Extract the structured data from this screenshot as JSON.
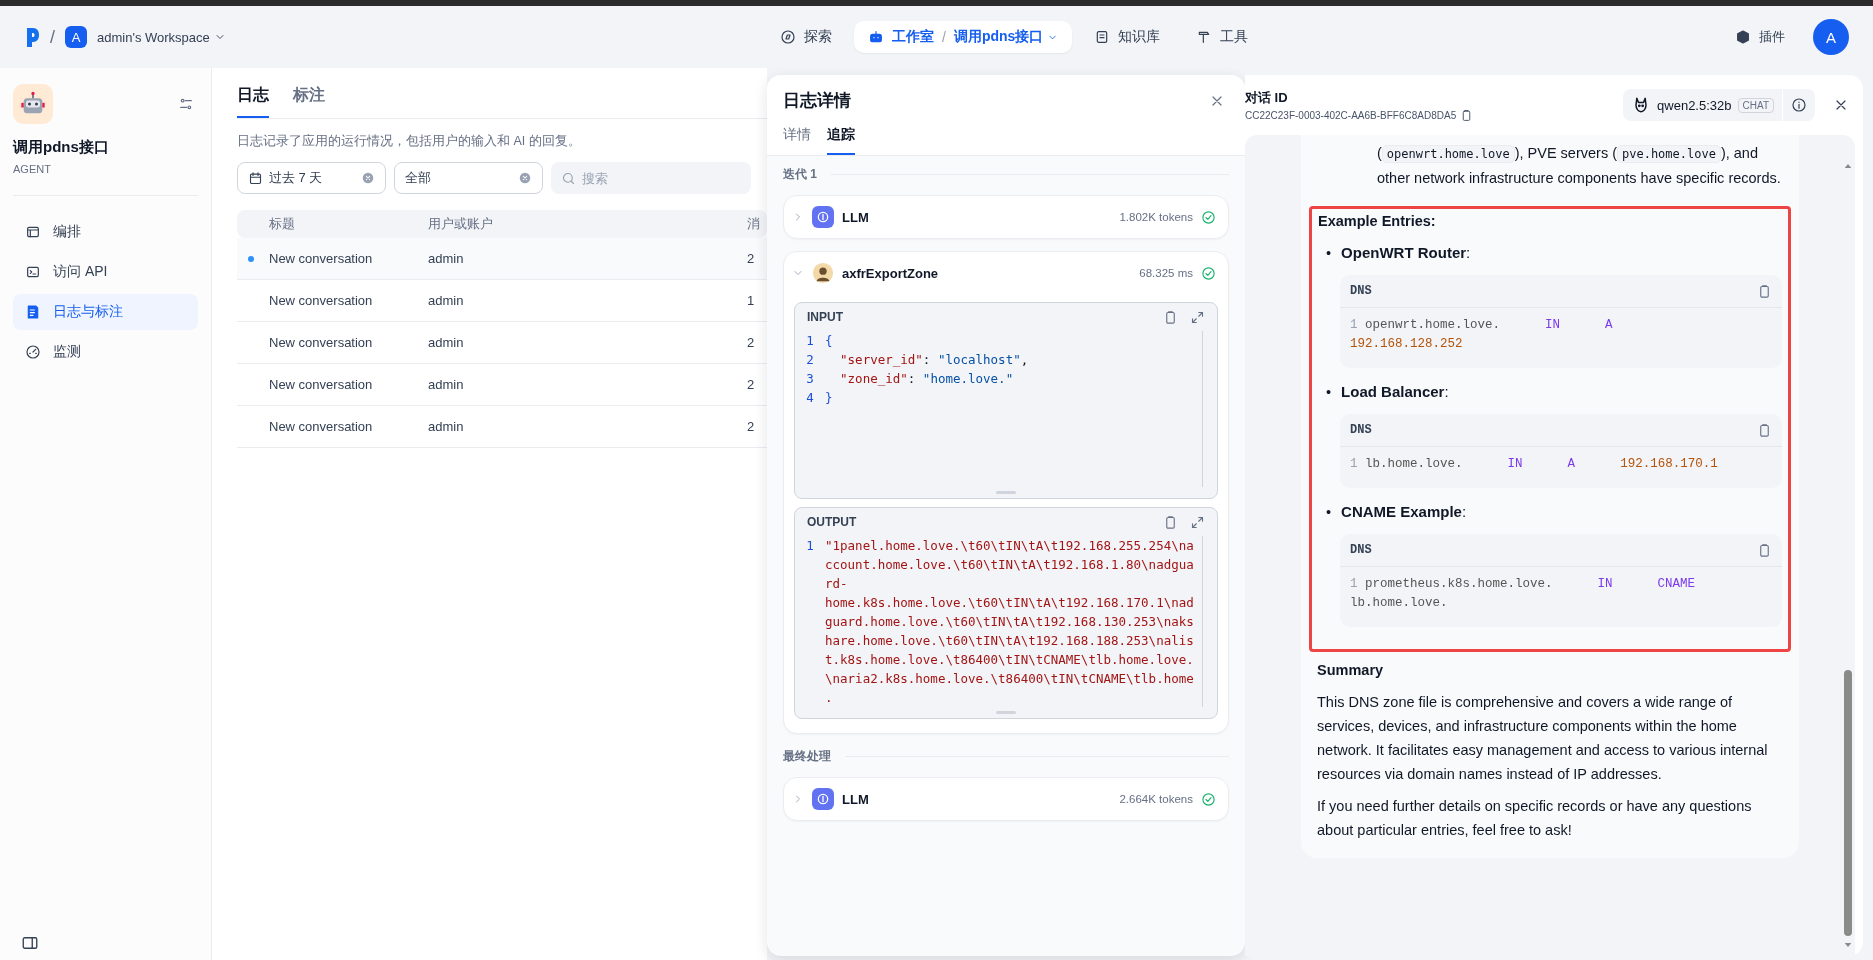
{
  "top_bar": {
    "separator": "/",
    "workspace": {
      "avatar": "A",
      "name": "admin's Workspace"
    },
    "nav": [
      {
        "label": "探索",
        "kind": "explore",
        "selected": false
      },
      {
        "label": "工作室",
        "kind": "studio",
        "selected": true,
        "app_separator": "/",
        "app": "调用pdns接口"
      },
      {
        "label": "知识库",
        "kind": "knowledge",
        "selected": false
      },
      {
        "label": "工具",
        "kind": "tools",
        "selected": false
      }
    ],
    "plugins": "插件",
    "avatar": "A"
  },
  "sidebar": {
    "app_name": "调用pdns接口",
    "app_type": "AGENT",
    "items": [
      {
        "label": "编排",
        "kind": "layout",
        "selected": false
      },
      {
        "label": "访问 API",
        "kind": "api",
        "selected": false
      },
      {
        "label": "日志与标注",
        "kind": "logs",
        "selected": true
      },
      {
        "label": "监测",
        "kind": "monitor",
        "selected": false
      }
    ]
  },
  "logs": {
    "tabs": [
      {
        "label": "日志",
        "selected": true
      },
      {
        "label": "标注",
        "selected": false
      }
    ],
    "description": "日志记录了应用的运行情况，包括用户的输入和 AI 的回复。",
    "filters": {
      "period": "过去 7 天",
      "status": "全部",
      "search_placeholder": "搜索"
    },
    "columns": [
      "标题",
      "用户或账户",
      "消"
    ],
    "rows": [
      {
        "title": "New conversation",
        "user": "admin",
        "messages": "2",
        "unread": true
      },
      {
        "title": "New conversation",
        "user": "admin",
        "messages": "1",
        "unread": false
      },
      {
        "title": "New conversation",
        "user": "admin",
        "messages": "2",
        "unread": false
      },
      {
        "title": "New conversation",
        "user": "admin",
        "messages": "2",
        "unread": false
      },
      {
        "title": "New conversation",
        "user": "admin",
        "messages": "2",
        "unread": false
      }
    ]
  },
  "log_detail": {
    "title": "日志详情",
    "tabs": [
      {
        "label": "详情",
        "selected": false
      },
      {
        "label": "追踪",
        "selected": true
      }
    ],
    "sections": [
      {
        "label": "迭代 1",
        "nodes": [
          {
            "kind": "llm",
            "name": "LLM",
            "metric": "1.802K tokens",
            "done": true,
            "expanded": false
          },
          {
            "kind": "tool",
            "name": "axfrExportZone",
            "metric": "68.325 ms",
            "done": true,
            "expanded": true,
            "input": {
              "label": "INPUT",
              "lines": [
                {
                  "n": "1",
                  "tokens": [
                    {
                      "kind": "punct",
                      "text": "{"
                    }
                  ]
                },
                {
                  "n": "2",
                  "tokens": [
                    {
                      "kind": "key",
                      "text": "  \"server_id\""
                    },
                    {
                      "kind": "plain",
                      "text": ": "
                    },
                    {
                      "kind": "string",
                      "text": "\"localhost\""
                    },
                    {
                      "kind": "plain",
                      "text": ","
                    }
                  ]
                },
                {
                  "n": "3",
                  "tokens": [
                    {
                      "kind": "key",
                      "text": "  \"zone_id\""
                    },
                    {
                      "kind": "plain",
                      "text": ": "
                    },
                    {
                      "kind": "string",
                      "text": "\"home.love.\""
                    }
                  ]
                },
                {
                  "n": "4",
                  "tokens": [
                    {
                      "kind": "punct",
                      "text": "}"
                    }
                  ]
                }
              ]
            },
            "output": {
              "label": "OUTPUT",
              "n": "1",
              "text": "\"1panel.home.love.\\t60\\tIN\\tA\\t192.168.255.254\\naccount.home.love.\\t60\\tIN\\tA\\t192.168.1.80\\nadguard-home.k8s.home.love.\\t60\\tIN\\tA\\t192.168.170.1\\nadguard.home.love.\\t60\\tIN\\tA\\t192.168.130.253\\nakshare.home.love.\\t60\\tIN\\tA\\t192.168.188.253\\nalist.k8s.home.love.\\t86400\\tIN\\tCNAME\\tlb.home.love.\\naria2.k8s.home.love.\\t86400\\tIN\\tCNAME\\tlb.home."
            }
          }
        ]
      },
      {
        "label": "最终处理",
        "nodes": [
          {
            "kind": "llm",
            "name": "LLM",
            "metric": "2.664K tokens",
            "done": true,
            "expanded": false
          }
        ]
      }
    ]
  },
  "conversation": {
    "id_label": "对话 ID",
    "id": "CC22C23F-0003-402C-AA6B-BFF6C8AD8DA5",
    "model": "qwen2.5:32b",
    "mode": "CHAT",
    "intro": [
      {
        "kind": "text",
        "text": "("
      },
      {
        "kind": "code",
        "text": "openwrt.home.love"
      },
      {
        "kind": "text",
        "text": "), PVE servers ("
      },
      {
        "kind": "code",
        "text": "pve.home.love"
      },
      {
        "kind": "text",
        "text": "), and other network infrastructure components have specific records."
      }
    ],
    "examples": {
      "highlight": true,
      "heading": "Example Entries:",
      "entries": [
        {
          "bullet": "•",
          "label": "**OpenWRT Router**:",
          "code": {
            "lang": "DNS",
            "n": "1",
            "tokens": [
              {
                "kind": "name",
                "text": "openwrt.home.love."
              },
              {
                "kind": "keyword",
                "text": "IN"
              },
              {
                "kind": "keyword",
                "text": "A"
              },
              {
                "kind": "number",
                "text": "192.168.128.252"
              }
            ]
          }
        },
        {
          "bullet": "•",
          "label": "**Load Balancer**:",
          "code": {
            "lang": "DNS",
            "n": "1",
            "tokens": [
              {
                "kind": "name",
                "text": "lb.home.love."
              },
              {
                "kind": "keyword",
                "text": "IN"
              },
              {
                "kind": "keyword",
                "text": "A"
              },
              {
                "kind": "number",
                "text": "192.168.170.1"
              }
            ]
          }
        },
        {
          "bullet": "•",
          "label": "**CNAME Example**:",
          "code": {
            "lang": "DNS",
            "n": "1",
            "tokens": [
              {
                "kind": "name",
                "text": "prometheus.k8s.home.love."
              },
              {
                "kind": "keyword",
                "text": "IN"
              },
              {
                "kind": "keyword",
                "text": "CNAME"
              },
              {
                "kind": "name",
                "text": "lb.home.love."
              }
            ]
          }
        }
      ]
    },
    "summary_heading": "Summary",
    "paragraphs": [
      "This DNS zone file is comprehensive and covers a wide range of services, devices, and infrastructure components within the home network. It facilitates easy management and access to various internal resources via domain names instead of IP addresses.",
      "If you need further details on specific records or have any questions about particular entries, feel free to ask!"
    ]
  }
}
